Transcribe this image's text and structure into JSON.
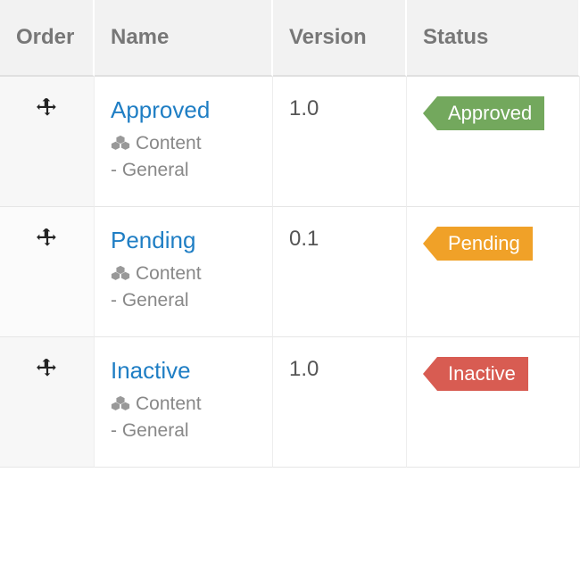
{
  "columns": {
    "order": "Order",
    "name": "Name",
    "version": "Version",
    "status": "Status"
  },
  "status_colors": {
    "approved": "#73a85d",
    "pending": "#f0a128",
    "inactive": "#d85c52"
  },
  "rows": [
    {
      "name": "Approved",
      "type_icon": "cubes-icon",
      "type_label": "Content",
      "subtype_label": "- General",
      "version": "1.0",
      "status_label": "Approved",
      "status_key": "approved"
    },
    {
      "name": "Pending",
      "type_icon": "cubes-icon",
      "type_label": "Content",
      "subtype_label": "- General",
      "version": "0.1",
      "status_label": "Pending",
      "status_key": "pending"
    },
    {
      "name": "Inactive",
      "type_icon": "cubes-icon",
      "type_label": "Content",
      "subtype_label": "- General",
      "version": "1.0",
      "status_label": "Inactive",
      "status_key": "inactive"
    }
  ]
}
